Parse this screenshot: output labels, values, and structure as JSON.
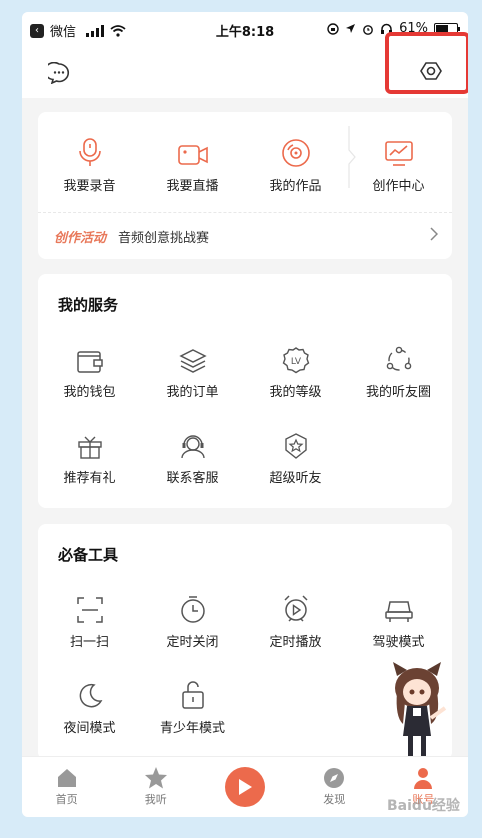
{
  "status": {
    "carrier": "微信",
    "time": "上午8:18",
    "battery": "61%"
  },
  "create": {
    "items": [
      {
        "label": "我要录音",
        "icon": "microphone-icon"
      },
      {
        "label": "我要直播",
        "icon": "video-camera-icon"
      },
      {
        "label": "我的作品",
        "icon": "disc-icon"
      },
      {
        "label": "创作中心",
        "icon": "monitor-chart-icon"
      }
    ],
    "activity_tag": "创作活动",
    "activity_text": "音频创意挑战赛"
  },
  "services": {
    "title": "我的服务",
    "items": [
      {
        "label": "我的钱包",
        "icon": "wallet-icon"
      },
      {
        "label": "我的订单",
        "icon": "layers-icon"
      },
      {
        "label": "我的等级",
        "icon": "level-badge-icon"
      },
      {
        "label": "我的听友圈",
        "icon": "friend-circle-icon"
      },
      {
        "label": "推荐有礼",
        "icon": "gift-icon"
      },
      {
        "label": "联系客服",
        "icon": "headset-icon"
      },
      {
        "label": "超级听友",
        "icon": "super-star-badge-icon"
      }
    ]
  },
  "tools": {
    "title": "必备工具",
    "items": [
      {
        "label": "扫一扫",
        "icon": "scan-icon"
      },
      {
        "label": "定时关闭",
        "icon": "timer-icon"
      },
      {
        "label": "定时播放",
        "icon": "alarm-play-icon"
      },
      {
        "label": "驾驶模式",
        "icon": "car-icon"
      },
      {
        "label": "夜间模式",
        "icon": "moon-icon"
      },
      {
        "label": "青少年模式",
        "icon": "lock-icon"
      }
    ]
  },
  "tabs": [
    {
      "label": "首页",
      "icon": "home-icon"
    },
    {
      "label": "我听",
      "icon": "star-icon"
    },
    {
      "label": "",
      "icon": "play-icon"
    },
    {
      "label": "发现",
      "icon": "compass-icon"
    },
    {
      "label": "账号",
      "icon": "account-icon"
    }
  ],
  "watermark": "Baidu经验",
  "colors": {
    "accent": "#ec6a4c",
    "highlight": "#e53935"
  }
}
